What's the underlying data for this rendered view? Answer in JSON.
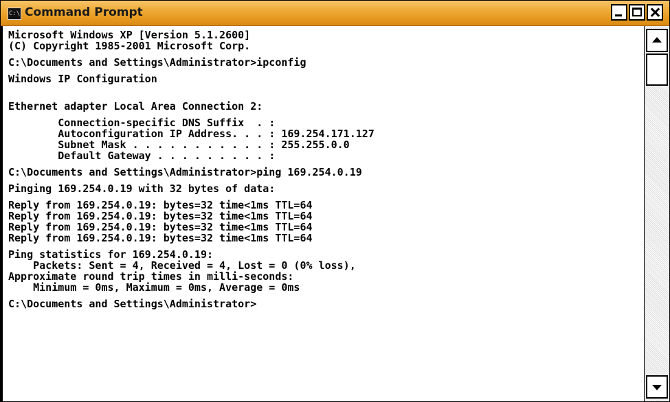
{
  "window": {
    "icon_text": "C:\\",
    "title": "Command Prompt"
  },
  "console": {
    "lines": [
      "Microsoft Windows XP [Version 5.1.2600]",
      "(C) Copyright 1985-2001 Microsoft Corp.",
      "",
      "C:\\Documents and Settings\\Administrator>ipconfig",
      "",
      "Windows IP Configuration",
      "",
      "",
      "Ethernet adapter Local Area Connection 2:",
      "",
      "        Connection-specific DNS Suffix  . :",
      "        Autoconfiguration IP Address. . . : 169.254.171.127",
      "        Subnet Mask . . . . . . . . . . . : 255.255.0.0",
      "        Default Gateway . . . . . . . . . :",
      "",
      "C:\\Documents and Settings\\Administrator>ping 169.254.0.19",
      "",
      "Pinging 169.254.0.19 with 32 bytes of data:",
      "",
      "Reply from 169.254.0.19: bytes=32 time<1ms TTL=64",
      "Reply from 169.254.0.19: bytes=32 time<1ms TTL=64",
      "Reply from 169.254.0.19: bytes=32 time<1ms TTL=64",
      "Reply from 169.254.0.19: bytes=32 time<1ms TTL=64",
      "",
      "Ping statistics for 169.254.0.19:",
      "    Packets: Sent = 4, Received = 4, Lost = 0 (0% loss),",
      "Approximate round trip times in milli-seconds:",
      "    Minimum = 0ms, Maximum = 0ms, Average = 0ms",
      "",
      "C:\\Documents and Settings\\Administrator>"
    ]
  },
  "icons": {
    "minimize": "minimize-icon",
    "maximize": "maximize-icon",
    "close": "close-icon",
    "scroll_up": "arrow-up-icon",
    "scroll_down": "arrow-down-icon"
  },
  "colors": {
    "titlebar": "#e79a1f",
    "console_bg": "#ffffff",
    "console_text": "#000000"
  }
}
